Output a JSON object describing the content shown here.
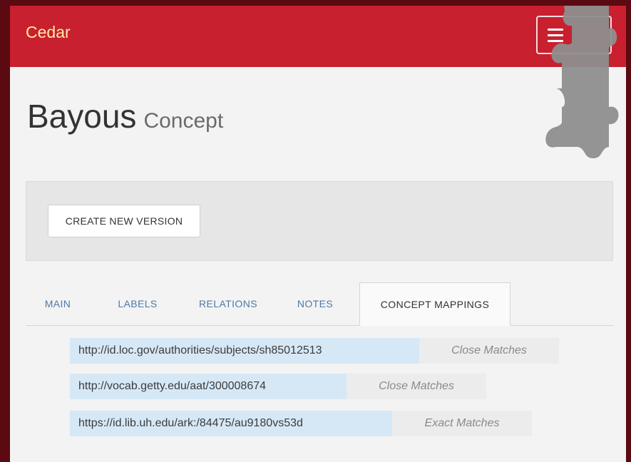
{
  "navbar": {
    "brand": "Cedar",
    "menu_icon": "hamburger-icon"
  },
  "header": {
    "title": "Bayous",
    "subtitle": "Concept"
  },
  "toolbar": {
    "create_label": "CREATE NEW VERSION"
  },
  "tabs": [
    {
      "label": "MAIN",
      "active": false
    },
    {
      "label": "LABELS",
      "active": false
    },
    {
      "label": "RELATIONS",
      "active": false
    },
    {
      "label": "NOTES",
      "active": false
    },
    {
      "label": "CONCEPT MAPPINGS",
      "active": true
    }
  ],
  "mappings": [
    {
      "url": "http://id.loc.gov/authorities/subjects/sh85012513",
      "type": "Close Matches"
    },
    {
      "url": "http://vocab.getty.edu/aat/300008674",
      "type": "Close Matches"
    },
    {
      "url": "https://id.lib.uh.edu/ark:/84475/au9180vs53d",
      "type": "Exact Matches"
    }
  ],
  "colors": {
    "navbar": "#c8202f",
    "brand_text": "#ffe9a6",
    "tab_link": "#4d7aa8",
    "mapping_url_bg": "#d6e8f6"
  }
}
